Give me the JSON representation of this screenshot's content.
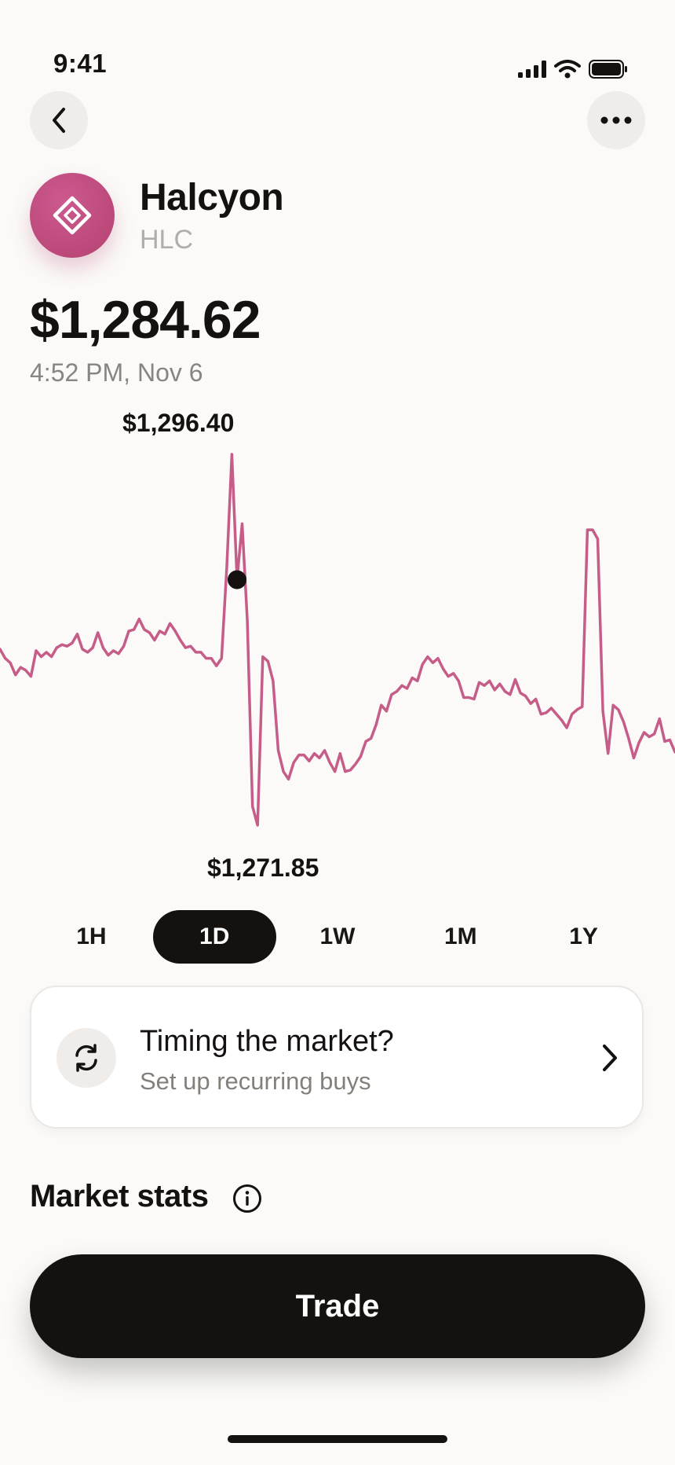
{
  "status_bar": {
    "time": "9:41"
  },
  "asset": {
    "name": "Halcyon",
    "ticker": "HLC",
    "brand_color": "#c14f83"
  },
  "quote": {
    "price": "$1,284.62",
    "timestamp": "4:52 PM, Nov 6"
  },
  "chart_data": {
    "type": "line",
    "high_label": "$1,296.40",
    "low_label": "$1,271.85",
    "ylim": [
      1271.85,
      1296.4
    ],
    "line_color": "#c55d88",
    "values": [
      1283.5,
      1282.9,
      1282.6,
      1281.8,
      1282.3,
      1282.1,
      1281.7,
      1283.4,
      1283.0,
      1283.3,
      1283.0,
      1283.6,
      1283.8,
      1283.7,
      1283.9,
      1284.5,
      1283.5,
      1283.3,
      1283.6,
      1284.6,
      1283.6,
      1283.1,
      1283.4,
      1283.2,
      1283.7,
      1284.7,
      1284.8,
      1285.5,
      1284.8,
      1284.6,
      1284.1,
      1284.7,
      1284.5,
      1285.2,
      1284.7,
      1284.1,
      1283.6,
      1283.7,
      1283.3,
      1283.3,
      1282.9,
      1282.9,
      1282.4,
      1282.9,
      1288.9,
      1296.4,
      1288.1,
      1291.8,
      1285.4,
      1273.1,
      1271.85,
      1283.0,
      1282.7,
      1281.4,
      1276.8,
      1275.4,
      1274.9,
      1276.0,
      1276.5,
      1276.5,
      1276.1,
      1276.6,
      1276.3,
      1276.8,
      1276.0,
      1275.4,
      1276.6,
      1275.4,
      1275.5,
      1275.9,
      1276.4,
      1277.4,
      1277.6,
      1278.5,
      1279.8,
      1279.4,
      1280.5,
      1280.7,
      1281.1,
      1280.9,
      1281.6,
      1281.4,
      1282.5,
      1283.0,
      1282.6,
      1282.9,
      1282.2,
      1281.7,
      1281.9,
      1281.4,
      1280.3,
      1280.3,
      1280.2,
      1281.3,
      1281.1,
      1281.4,
      1280.8,
      1281.2,
      1280.7,
      1280.5,
      1281.5,
      1280.6,
      1280.4,
      1279.9,
      1280.2,
      1279.2,
      1279.3,
      1279.6,
      1279.2,
      1278.8,
      1278.3,
      1279.2,
      1279.5,
      1279.7,
      1291.4,
      1291.4,
      1290.8,
      1279.4,
      1276.6,
      1279.8,
      1279.5,
      1278.7,
      1277.6,
      1276.3,
      1277.3,
      1278.0,
      1277.7,
      1277.9,
      1278.9,
      1277.4,
      1277.5,
      1276.7
    ],
    "marker_index": 46
  },
  "ranges": {
    "items": [
      {
        "label": "1H"
      },
      {
        "label": "1D"
      },
      {
        "label": "1W"
      },
      {
        "label": "1M"
      },
      {
        "label": "1Y"
      }
    ],
    "active": "1D"
  },
  "promo": {
    "title": "Timing the market?",
    "subtitle": "Set up recurring buys"
  },
  "market_stats": {
    "title": "Market stats"
  },
  "cta": {
    "label": "Trade"
  }
}
